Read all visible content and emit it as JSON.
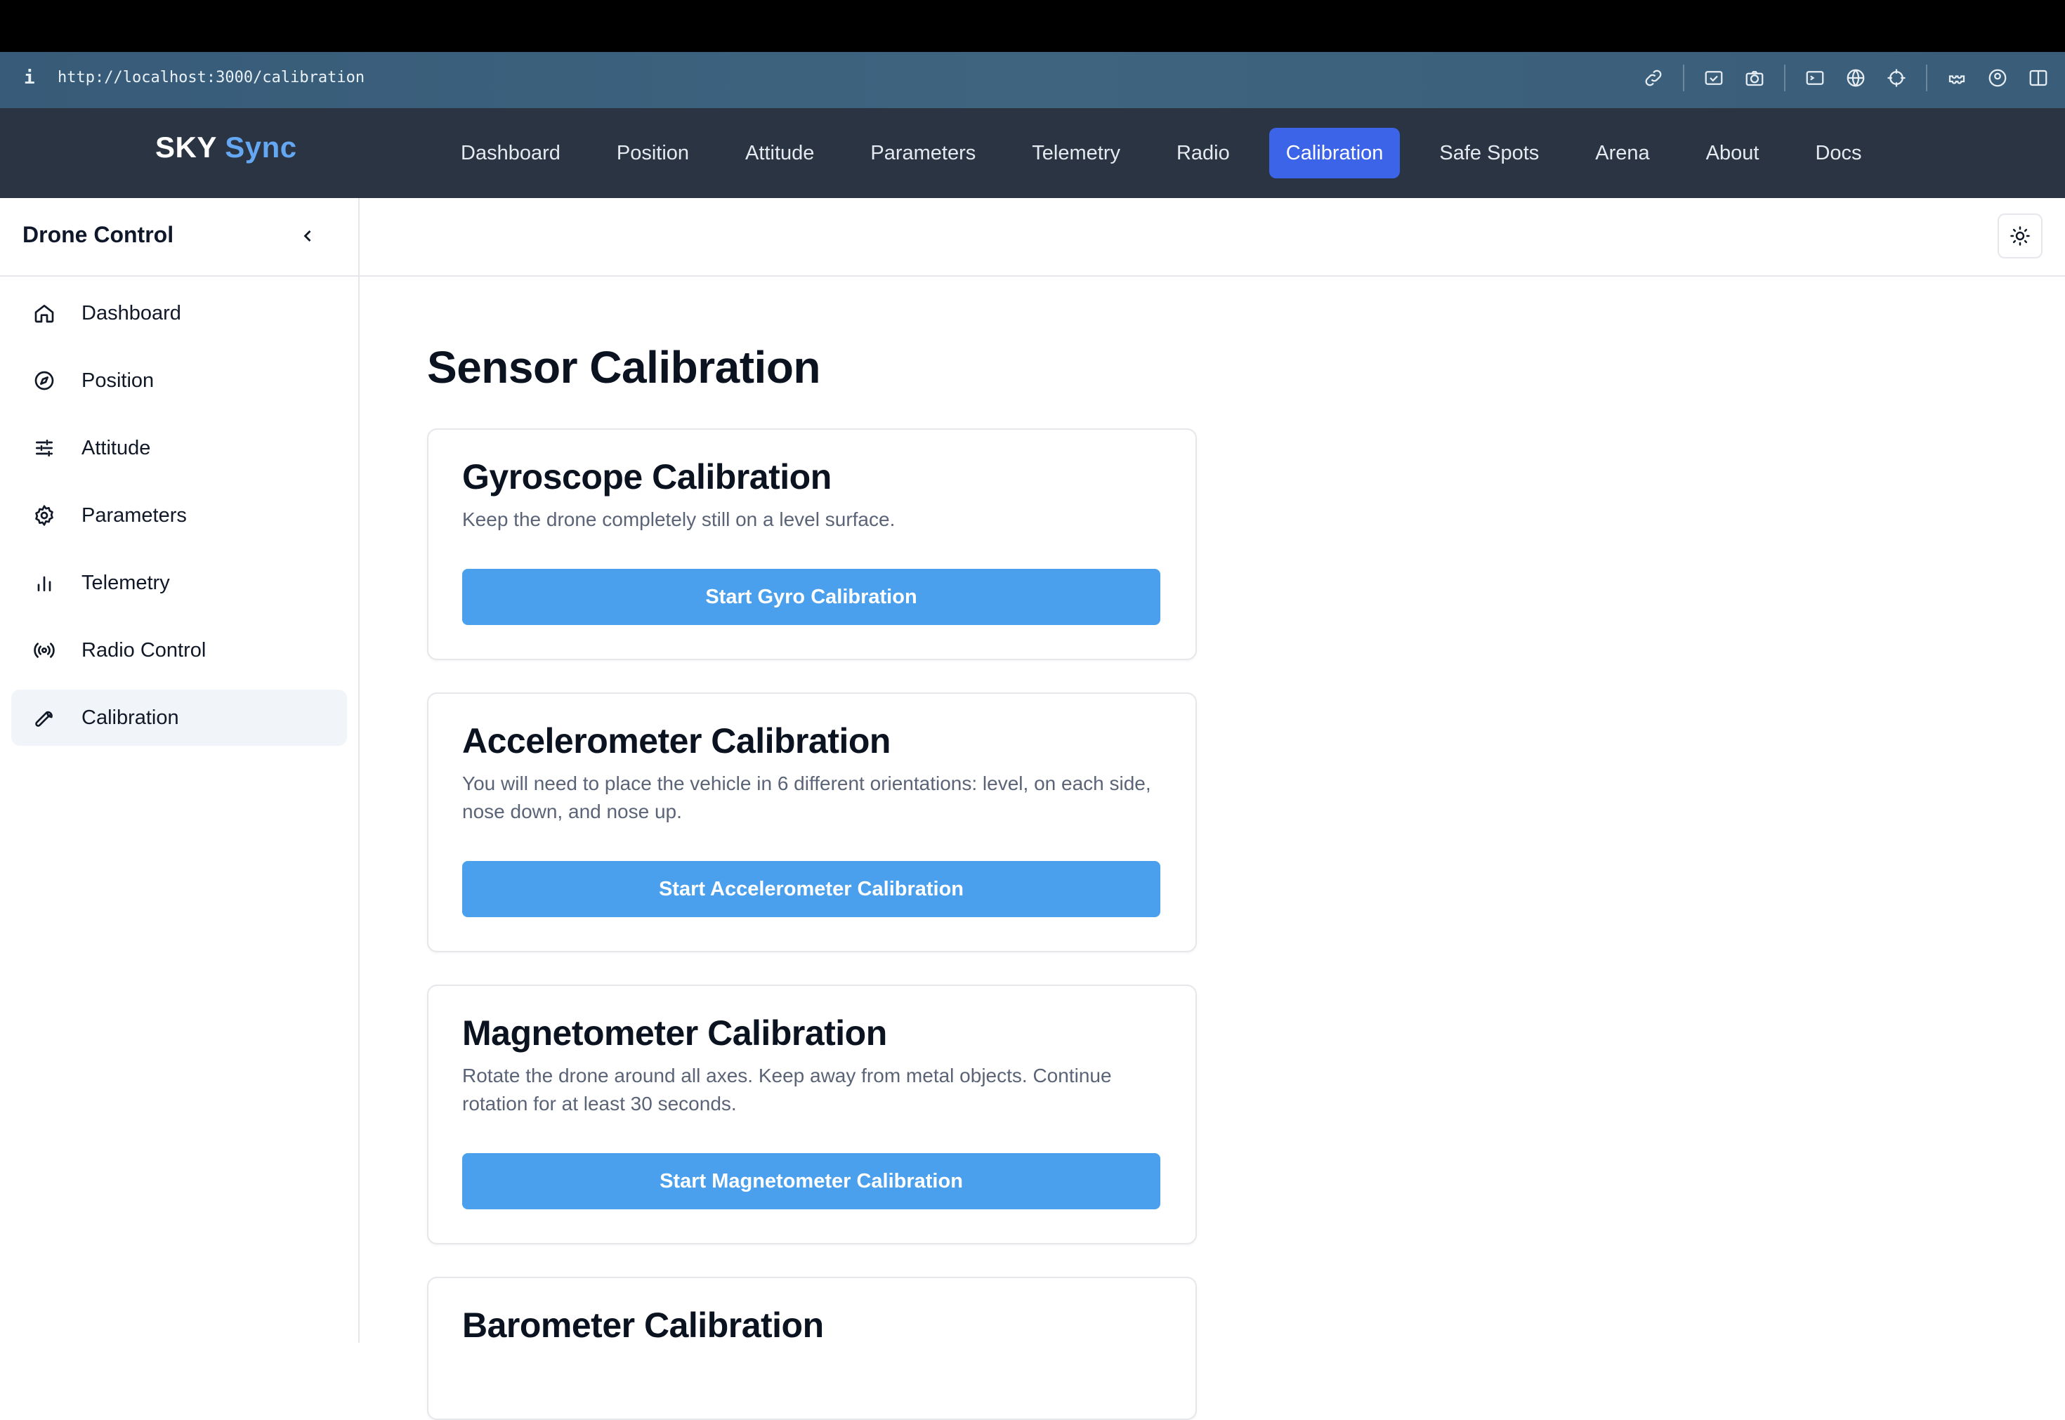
{
  "browser": {
    "info_glyph": "i",
    "url": "http://localhost:3000/calibration",
    "toolbar_icons": [
      "link-icon",
      "image-icon",
      "camera-icon",
      "terminal-icon",
      "globe-icon",
      "crosshair-icon",
      "extensions-icon",
      "profile-icon",
      "sidebar-icon"
    ]
  },
  "navbar": {
    "brand_primary": "SKY",
    "brand_accent": "Sync",
    "accent_color": "#64a7f2",
    "links": [
      "Dashboard",
      "Position",
      "Attitude",
      "Parameters",
      "Telemetry",
      "Radio",
      "Calibration",
      "Safe Spots",
      "Arena",
      "About",
      "Docs"
    ],
    "active": "Calibration",
    "active_color": "#3b64e8"
  },
  "sidebar": {
    "title": "Drone Control",
    "items": [
      {
        "label": "Dashboard",
        "icon": "home-icon"
      },
      {
        "label": "Position",
        "icon": "compass-icon"
      },
      {
        "label": "Attitude",
        "icon": "sliders-icon"
      },
      {
        "label": "Parameters",
        "icon": "gear-icon"
      },
      {
        "label": "Telemetry",
        "icon": "bar-chart-icon"
      },
      {
        "label": "Radio Control",
        "icon": "radio-icon"
      },
      {
        "label": "Calibration",
        "icon": "wrench-icon"
      }
    ],
    "active": "Calibration"
  },
  "main": {
    "title": "Sensor Calibration",
    "button_color": "#4ba0ee",
    "cards": [
      {
        "title": "Gyroscope Calibration",
        "description": "Keep the drone completely still on a level surface.",
        "button": "Start Gyro Calibration"
      },
      {
        "title": "Accelerometer Calibration",
        "description": "You will need to place the vehicle in 6 different orientations: level, on each side, nose down, and nose up.",
        "button": "Start Accelerometer Calibration"
      },
      {
        "title": "Magnetometer Calibration",
        "description": "Rotate the drone around all axes. Keep away from metal objects. Continue rotation for at least 30 seconds.",
        "button": "Start Magnetometer Calibration"
      },
      {
        "title": "Barometer Calibration"
      }
    ]
  }
}
